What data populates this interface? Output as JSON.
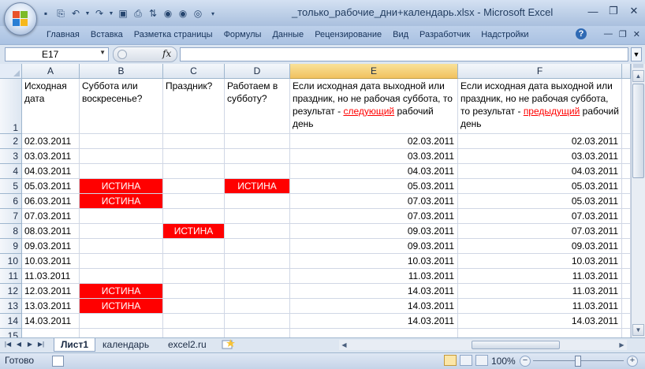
{
  "window": {
    "title": "_только_рабочие_дни+календарь.xlsx - Microsoft Excel",
    "controls": [
      "minimize-icon",
      "maximize-icon",
      "close-icon"
    ]
  },
  "quick_access": [
    "save-icon",
    "undo-icon",
    "redo-icon",
    "preview-icon",
    "print-icon",
    "sort-icon",
    "circle-icon",
    "circle-icon",
    "customize-icon"
  ],
  "ribbon": {
    "tabs": [
      "Главная",
      "Вставка",
      "Разметка страницы",
      "Формулы",
      "Данные",
      "Рецензирование",
      "Вид",
      "Разработчик",
      "Надстройки"
    ]
  },
  "formula_bar": {
    "name_box": "E17",
    "fx_label": "fx",
    "formula": ""
  },
  "grid": {
    "selected_column": "E",
    "columns": [
      "A",
      "B",
      "C",
      "D",
      "E",
      "F"
    ],
    "header_row": {
      "row_number": "1",
      "a": "Исходная дата",
      "b": "Суббота или воскресенье?",
      "c": "Праздник?",
      "d": "Работаем в субботу?",
      "e_pre": "Если исходная дата выходной или праздник, но не рабочая суббота, то результат - ",
      "e_red": "следующий",
      "e_post": " рабочий день",
      "f_pre": "Если исходная дата выходной или праздник, но не рабочая суббота, то результат - ",
      "f_red": "предыдущий",
      "f_post": " рабочий день"
    },
    "rows": [
      {
        "n": "2",
        "a": "02.03.2011",
        "b": "",
        "c": "",
        "d": "",
        "e": "02.03.2011",
        "f": "02.03.2011"
      },
      {
        "n": "3",
        "a": "03.03.2011",
        "b": "",
        "c": "",
        "d": "",
        "e": "03.03.2011",
        "f": "03.03.2011"
      },
      {
        "n": "4",
        "a": "04.03.2011",
        "b": "",
        "c": "",
        "d": "",
        "e": "04.03.2011",
        "f": "04.03.2011"
      },
      {
        "n": "5",
        "a": "05.03.2011",
        "b": "ИСТИНА",
        "c": "",
        "d": "ИСТИНА",
        "e": "05.03.2011",
        "f": "05.03.2011"
      },
      {
        "n": "6",
        "a": "06.03.2011",
        "b": "ИСТИНА",
        "c": "",
        "d": "",
        "e": "07.03.2011",
        "f": "05.03.2011"
      },
      {
        "n": "7",
        "a": "07.03.2011",
        "b": "",
        "c": "",
        "d": "",
        "e": "07.03.2011",
        "f": "07.03.2011"
      },
      {
        "n": "8",
        "a": "08.03.2011",
        "b": "",
        "c": "ИСТИНА",
        "d": "",
        "e": "09.03.2011",
        "f": "07.03.2011"
      },
      {
        "n": "9",
        "a": "09.03.2011",
        "b": "",
        "c": "",
        "d": "",
        "e": "09.03.2011",
        "f": "09.03.2011"
      },
      {
        "n": "10",
        "a": "10.03.2011",
        "b": "",
        "c": "",
        "d": "",
        "e": "10.03.2011",
        "f": "10.03.2011"
      },
      {
        "n": "11",
        "a": "11.03.2011",
        "b": "",
        "c": "",
        "d": "",
        "e": "11.03.2011",
        "f": "11.03.2011"
      },
      {
        "n": "12",
        "a": "12.03.2011",
        "b": "ИСТИНА",
        "c": "",
        "d": "",
        "e": "14.03.2011",
        "f": "11.03.2011"
      },
      {
        "n": "13",
        "a": "13.03.2011",
        "b": "ИСТИНА",
        "c": "",
        "d": "",
        "e": "14.03.2011",
        "f": "11.03.2011"
      },
      {
        "n": "14",
        "a": "14.03.2011",
        "b": "",
        "c": "",
        "d": "",
        "e": "14.03.2011",
        "f": "14.03.2011"
      },
      {
        "n": "15",
        "a": "",
        "b": "",
        "c": "",
        "d": "",
        "e": "",
        "f": ""
      }
    ],
    "highlight_color": "#ff0000"
  },
  "sheet_tabs": [
    "Лист1",
    "календарь",
    "excel2.ru"
  ],
  "status_bar": {
    "ready": "Готово",
    "zoom": "100%"
  }
}
